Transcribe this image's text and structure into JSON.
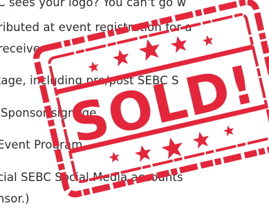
{
  "content": {
    "lines": [
      "C sees your logo? You can't go w",
      "ributed at event registration for a",
      "receive:",
      "kage, including pre/post SEBC S",
      "C Sponsor signage",
      "Event Program",
      "cial SEBC Social Media accounts",
      "nsor.)"
    ]
  },
  "stamp": {
    "text": "SOLD!",
    "color": "#e3263a"
  }
}
